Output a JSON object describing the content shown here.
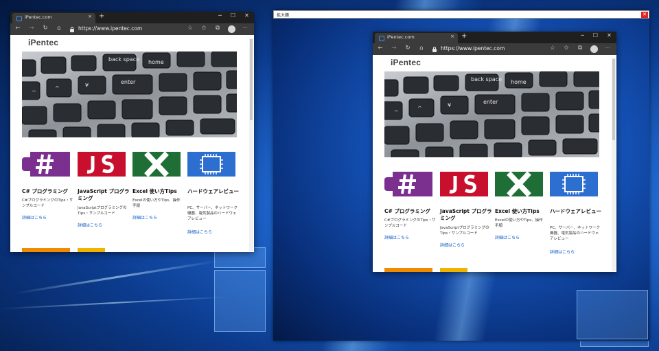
{
  "browser": {
    "tab_title": "iPentec.com",
    "tab_close": "×",
    "new_tab": "+",
    "url": "https://www.ipentec.com",
    "controls": {
      "minimize": "─",
      "maximize": "☐",
      "close": "✕"
    },
    "toolbar_icons": {
      "back": "←",
      "forward": "→",
      "refresh": "↻",
      "home": "⌂",
      "favorite": "☆",
      "favorites_bar": "✩",
      "collections": "⧉",
      "more": "···"
    }
  },
  "page": {
    "logo": "iPentec",
    "cards": [
      {
        "title": "C# プログラミング",
        "desc": "C#プログラミングのTips・サンプルコード",
        "link": "詳細はこちら",
        "color": "#7b2f8f",
        "icon": "csharp-logo-icon"
      },
      {
        "title": "JavaScript プログラミング",
        "desc": "JavaScriptプログラミングのTips・サンプルコード",
        "link": "詳細はこちら",
        "color": "#c8102e",
        "icon": "javascript-logo-icon"
      },
      {
        "title": "Excel 使い方Tips",
        "desc": "Excelの使い方やTips、操作手順",
        "link": "詳細はこちら",
        "color": "#1f6e35",
        "icon": "excel-logo-icon"
      },
      {
        "title": "ハードウェアレビュー",
        "desc": "PC、サーバー、ネットワーク機器、電気製品のハードウェアレビュー",
        "link": "詳細はこちら",
        "color": "#2c6fd1",
        "icon": "chip-icon"
      }
    ]
  },
  "magnifier": {
    "title": "拡大鏡",
    "close": "✕"
  },
  "keyboard": {
    "back_space": "back space",
    "home": "home",
    "enter": "enter",
    "yen": "¥",
    "caret": "^",
    "sym": "~"
  }
}
